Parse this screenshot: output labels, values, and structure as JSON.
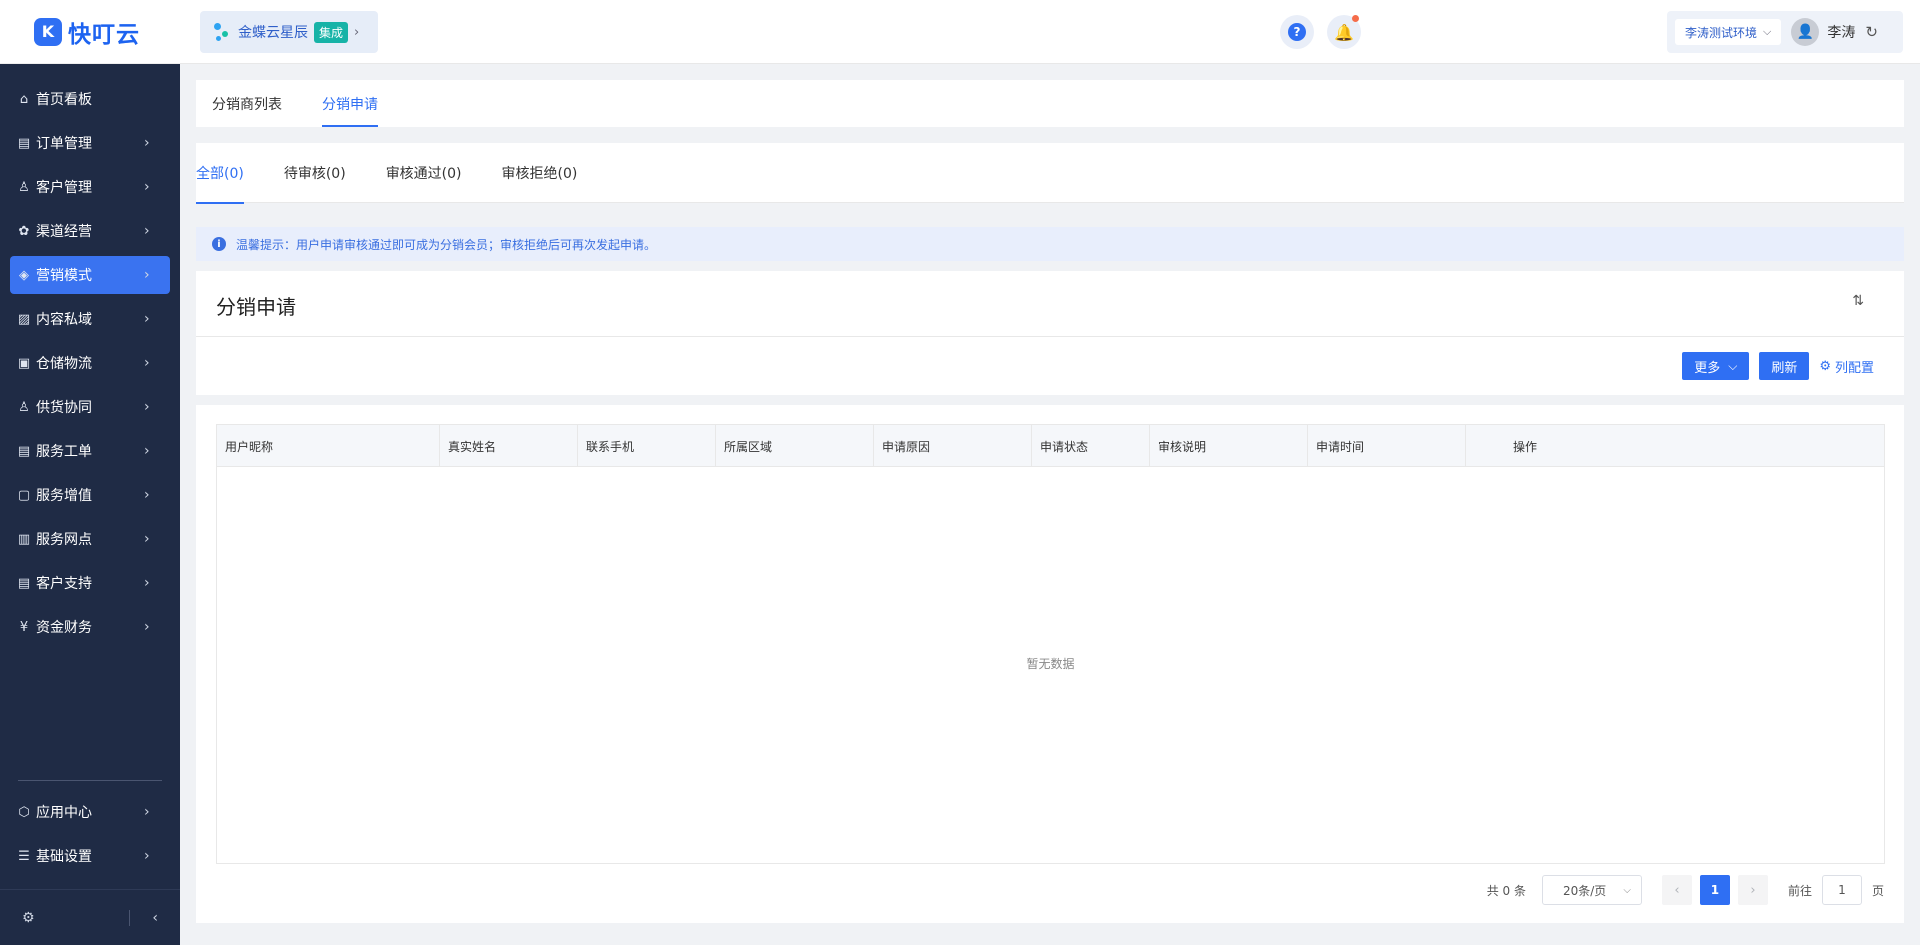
{
  "app": {
    "logo_mark": "K",
    "logo_text": "快叮云"
  },
  "sidebar": {
    "items": [
      {
        "label": "首页看板",
        "icon": "⌂",
        "has_arrow": false
      },
      {
        "label": "订单管理",
        "icon": "▤",
        "has_arrow": true
      },
      {
        "label": "客户管理",
        "icon": "♙",
        "has_arrow": true
      },
      {
        "label": "渠道经营",
        "icon": "✿",
        "has_arrow": true
      },
      {
        "label": "营销模式",
        "icon": "◈",
        "has_arrow": true,
        "active": true
      },
      {
        "label": "内容私域",
        "icon": "▨",
        "has_arrow": true
      },
      {
        "label": "仓储物流",
        "icon": "▣",
        "has_arrow": true
      },
      {
        "label": "供货协同",
        "icon": "♙",
        "has_arrow": true
      },
      {
        "label": "服务工单",
        "icon": "▤",
        "has_arrow": true
      },
      {
        "label": "服务增值",
        "icon": "▢",
        "has_arrow": true
      },
      {
        "label": "服务网点",
        "icon": "▥",
        "has_arrow": true
      },
      {
        "label": "客户支持",
        "icon": "▤",
        "has_arrow": true
      },
      {
        "label": "资金财务",
        "icon": "¥",
        "has_arrow": true
      }
    ],
    "bottom_items": [
      {
        "label": "应用中心",
        "icon": "⬡"
      },
      {
        "label": "基础设置",
        "icon": "☰"
      }
    ],
    "chevron": "›",
    "footer_gear": "⚙",
    "footer_collapse": "‹"
  },
  "header": {
    "org_name": "金蝶云星辰",
    "org_badge": "集成",
    "org_arrow": "›",
    "help_label": "?",
    "bell_icon": "🔔",
    "env_label": "李涛测试环境",
    "env_dropdown": "⌵",
    "user_name": "李涛",
    "refresh_glyph": "↻"
  },
  "top_tabs": [
    {
      "label": "分销商列表",
      "active": false
    },
    {
      "label": "分销申请",
      "active": true
    }
  ],
  "status_tabs": [
    {
      "label": "全部(0)",
      "active": true
    },
    {
      "label": "待审核(0)",
      "active": false
    },
    {
      "label": "审核通过(0)",
      "active": false
    },
    {
      "label": "审核拒绝(0)",
      "active": false
    }
  ],
  "notice": {
    "icon": "i",
    "text": "温馨提示：用户申请审核通过即可成为分销会员；审核拒绝后可再次发起申请。"
  },
  "page": {
    "title": "分销申请",
    "sort_glyph": "⇅",
    "more_label": "更多",
    "more_dropdown": "⌵",
    "refresh_label": "刷新",
    "column_config_label": "列配置",
    "gear_glyph": "⚙"
  },
  "table": {
    "columns": [
      {
        "label": "用户昵称",
        "width": 223
      },
      {
        "label": "真实姓名",
        "width": 138
      },
      {
        "label": "联系手机",
        "width": 138
      },
      {
        "label": "所属区域",
        "width": 158
      },
      {
        "label": "申请原因",
        "width": 158
      },
      {
        "label": "申请状态",
        "width": 118
      },
      {
        "label": "审核说明",
        "width": 158
      },
      {
        "label": "申请时间",
        "width": 158
      },
      {
        "label": "操作",
        "width": 118
      }
    ],
    "empty_text": "暂无数据"
  },
  "pagination": {
    "total_text": "共 0 条",
    "page_size": "20条/页",
    "page_size_dropdown": "⌵",
    "prev_glyph": "‹",
    "current_page": "1",
    "next_glyph": "›",
    "goto_prefix": "前往",
    "goto_value": "1",
    "goto_suffix": "页"
  },
  "colors": {
    "primary": "#2f6ff3",
    "sidebar_bg": "#1f2b45",
    "active_nav": "#3a73f0"
  }
}
